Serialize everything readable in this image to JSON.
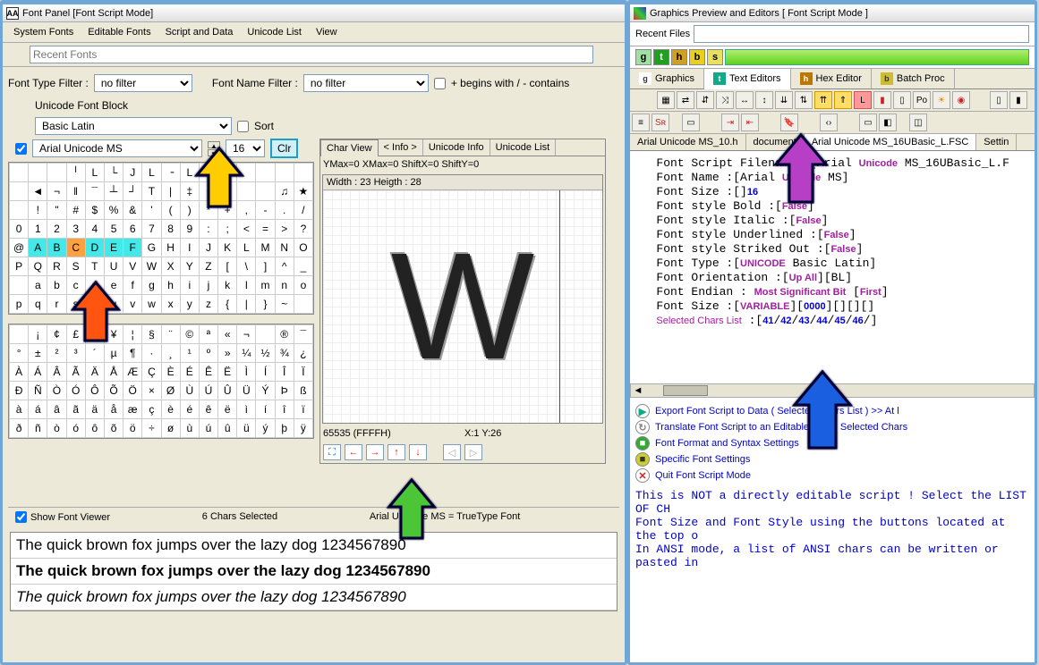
{
  "leftPanel": {
    "title": "Font Panel [Font Script Mode]",
    "menus": [
      "System Fonts",
      "Editable Fonts",
      "Script and Data",
      "Unicode List",
      "View"
    ],
    "recentLabel": "Recent Fonts",
    "filter": {
      "typeLabel": "Font Type Filter :",
      "typeValue": "no filter",
      "nameLabel": "Font Name Filter :",
      "nameValue": "no filter",
      "containsLabel": "+ begins with / - contains"
    },
    "block": {
      "label": "Unicode Font Block",
      "value": "Basic Latin",
      "sortLabel": "Sort"
    },
    "font": {
      "name": "Arial Unicode MS",
      "size": "16",
      "clr": "Clr"
    },
    "charView": {
      "tabs": [
        "Char View",
        "< Info >",
        "Unicode Info",
        "Unicode List"
      ],
      "ymax": "YMax=0  XMax=0  ShiftX=0  ShiftY=0",
      "dims": "Width : 23  Heigth : 28",
      "code": "65535  (FFFFH)",
      "pos": "X:1 Y:26"
    },
    "status": {
      "viewerLabel": "Show Font Viewer",
      "selected": "6 Chars Selected",
      "fontInfo": "Arial Unicode MS = TrueType Font"
    },
    "preview": {
      "line1": "The quick brown fox jumps over the lazy dog 1234567890",
      "line2": "The quick brown fox jumps over the lazy dog 1234567890",
      "line3": "The quick brown fox jumps over the lazy dog 1234567890"
    },
    "grid1": [
      [
        "",
        "",
        "",
        "╵",
        "L",
        "└",
        "J",
        "L",
        "╶",
        "L",
        "",
        "",
        "",
        "",
        "",
        ""
      ],
      [
        "",
        "◄",
        "¬",
        "‖",
        "¯",
        "┴",
        "┘",
        "T",
        "|",
        "‡",
        "•",
        "",
        "",
        "",
        "♫",
        "★"
      ],
      [
        "",
        "!",
        "\"",
        "#",
        "$",
        "%",
        "&",
        "'",
        "(",
        ")",
        "*",
        "+",
        ",",
        "-",
        ".",
        "/"
      ],
      [
        "0",
        "1",
        "2",
        "3",
        "4",
        "5",
        "6",
        "7",
        "8",
        "9",
        ":",
        ";",
        "<",
        "=",
        ">",
        "?"
      ],
      [
        "@",
        "A",
        "B",
        "C",
        "D",
        "E",
        "F",
        "G",
        "H",
        "I",
        "J",
        "K",
        "L",
        "M",
        "N",
        "O"
      ],
      [
        "P",
        "Q",
        "R",
        "S",
        "T",
        "U",
        "V",
        "W",
        "X",
        "Y",
        "Z",
        "[",
        "\\",
        "]",
        "^",
        "_"
      ],
      [
        "",
        "a",
        "b",
        "c",
        "d",
        "e",
        "f",
        "g",
        "h",
        "i",
        "j",
        "k",
        "l",
        "m",
        "n",
        "o"
      ],
      [
        "p",
        "q",
        "r",
        "s",
        "t",
        "u",
        "v",
        "w",
        "x",
        "y",
        "z",
        "{",
        "|",
        "}",
        "~",
        ""
      ]
    ],
    "grid2": [
      [
        "",
        "¡",
        "¢",
        "£",
        "¤",
        "¥",
        "¦",
        "§",
        "¨",
        "©",
        "ª",
        "«",
        "¬",
        "",
        "®",
        "¯"
      ],
      [
        "°",
        "±",
        "²",
        "³",
        "´",
        "µ",
        "¶",
        "·",
        "¸",
        "¹",
        "º",
        "»",
        "¼",
        "½",
        "¾",
        "¿"
      ],
      [
        "À",
        "Á",
        "Â",
        "Ã",
        "Ä",
        "Å",
        "Æ",
        "Ç",
        "È",
        "É",
        "Ê",
        "Ë",
        "Ì",
        "Í",
        "Î",
        "Ï"
      ],
      [
        "Ð",
        "Ñ",
        "Ò",
        "Ó",
        "Ô",
        "Õ",
        "Ö",
        "×",
        "Ø",
        "Ù",
        "Ú",
        "Û",
        "Ü",
        "Ý",
        "Þ",
        "ß"
      ],
      [
        "à",
        "á",
        "â",
        "ã",
        "ä",
        "å",
        "æ",
        "ç",
        "è",
        "é",
        "ê",
        "ë",
        "ì",
        "í",
        "î",
        "ï"
      ],
      [
        "ð",
        "ñ",
        "ò",
        "ó",
        "ô",
        "õ",
        "ö",
        "÷",
        "ø",
        "ù",
        "ú",
        "û",
        "ü",
        "ý",
        "þ",
        "ÿ"
      ]
    ]
  },
  "rightPanel": {
    "title": "Graphics Preview and Editors [ Font Script Mode ]",
    "recentLabel": "Recent Files",
    "chips": [
      "g",
      "t",
      "h",
      "b",
      "s"
    ],
    "mainTabs": [
      {
        "icon": "g",
        "label": "Graphics"
      },
      {
        "icon": "t",
        "label": "Text Editors"
      },
      {
        "icon": "h",
        "label": "Hex Editor"
      },
      {
        "icon": "b",
        "label": "Batch Proc"
      }
    ],
    "docTabs": [
      "Arial Unicode MS_10.h",
      "document",
      "Arial Unicode MS_16UBasic_L.FSC",
      "Settin"
    ],
    "codeLines": [
      {
        "t": "Font Script Filename :[Arial ",
        "u": "Unicode",
        "t2": " MS_16UBasic_L.F"
      },
      {
        "t": "Font Name :[Arial ",
        "u": "Unicode",
        "t2": " MS]"
      },
      {
        "t": "Font Size :[",
        "v": "16",
        "t2": "]"
      },
      {
        "t": "Font style Bold :[",
        "u": "False",
        "t2": "]"
      },
      {
        "t": "Font style Italic :[",
        "u": "False",
        "t2": "]"
      },
      {
        "t": "Font style Underlined :[",
        "u": "False",
        "t2": "]"
      },
      {
        "t": "Font style Striked Out :[",
        "u": "False",
        "t2": "]"
      },
      {
        "t": "Font Type :[",
        "u": "UNICODE",
        "t2": " Basic Latin]"
      },
      {
        "t": "Font Orientation :[",
        "u": "Up All",
        "t2": "][BL]"
      },
      {
        "t": "Font Endian : ",
        "u": "Most Significant Bit",
        "t2": " [",
        "u2": "First",
        "t3": "]"
      },
      {
        "t": "Font Size :[",
        "u": "VARIABLE",
        "t2": "][",
        "v": "0",
        "t3": "][",
        "v2": "0",
        "t4": "][",
        "v3": "0",
        "t5": "][",
        "v4": "0",
        "t6": "]"
      },
      {
        "p": "Selected Chars List",
        "t": " :[",
        "v": "41",
        "s": "/",
        "v2": "42",
        "s2": "/",
        "v3": "43",
        "s3": "/",
        "v4": "44",
        "s4": "/",
        "v5": "45",
        "s5": "/",
        "v6": "46",
        "s6": "/]"
      }
    ],
    "actions": [
      {
        "icon": "▶",
        "bg": "#fff",
        "fg": "#1a8",
        "label": "Export Font Script to Data  ( Selected Chars List ) >> At l"
      },
      {
        "icon": "↻",
        "bg": "#fff",
        "fg": "#888",
        "label": "Translate Font Script to an Editable Font ( Selected Chars"
      },
      {
        "icon": "■",
        "bg": "#3a3",
        "fg": "#fff",
        "label": "Font Format and Syntax Settings"
      },
      {
        "icon": "■",
        "bg": "#cc3",
        "fg": "#333",
        "label": "Specific Font Settings"
      },
      {
        "icon": "✕",
        "bg": "#fff",
        "fg": "#c22",
        "label": "Quit Font Script Mode"
      }
    ],
    "note1": "This is NOT a directly editable script ! Select the LIST OF CH",
    "note2": "Font Size and Font Style using the buttons located at the top o",
    "note3": " In ANSI mode, a list of ANSI chars can be written or pasted in"
  }
}
